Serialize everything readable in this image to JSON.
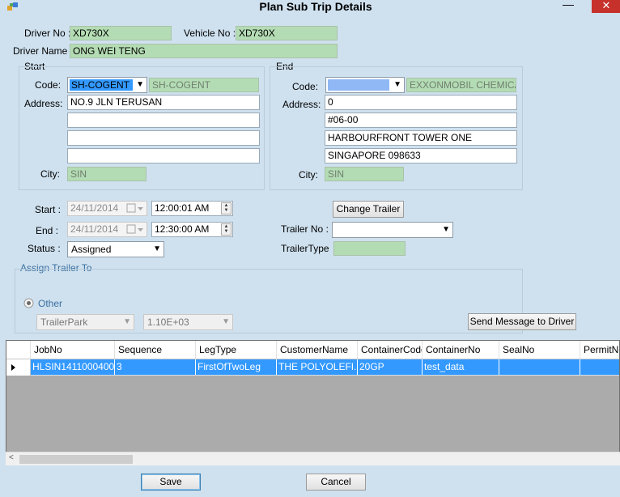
{
  "window": {
    "title": "Plan Sub Trip Details",
    "minimize_glyph": "—",
    "close_glyph": "✕"
  },
  "header": {
    "driver_no_label": "Driver No :",
    "driver_no_value": "XD730X",
    "vehicle_no_label": "Vehicle No :",
    "vehicle_no_value": "XD730X",
    "driver_name_label": "Driver Name :",
    "driver_name_value": "ONG WEI TENG"
  },
  "start": {
    "group_label": "Start",
    "code_label": "Code:",
    "code_selected": "SH-COGENT",
    "code_display": "SH-COGENT",
    "address_label": "Address:",
    "address_lines": [
      "NO.9 JLN TERUSAN",
      "",
      "",
      ""
    ],
    "city_label": "City:",
    "city_value": "SIN"
  },
  "end": {
    "group_label": "End",
    "code_label": "Code:",
    "code_selected": "",
    "code_display": "EXXONMOBIL CHEMICAL A",
    "address_label": "Address:",
    "address_lines": [
      "0",
      "#06-00",
      "HARBOURFRONT TOWER ONE",
      "SINGAPORE 098633"
    ],
    "city_label": "City:",
    "city_value": "SIN"
  },
  "schedule": {
    "start_label": "Start :",
    "start_date": "24/11/2014",
    "start_time": "12:00:01 AM",
    "end_label": "End :",
    "end_date": "24/11/2014",
    "end_time": "12:30:00 AM",
    "status_label": "Status :",
    "status_value": "Assigned"
  },
  "trailer": {
    "change_trailer_button": "Change Trailer",
    "trailer_no_label": "Trailer No :",
    "trailer_no_value": "",
    "trailer_type_label": "TrailerType",
    "trailer_type_value": ""
  },
  "assign": {
    "group_label": "Assign Trailer To",
    "other_label": "Other",
    "trailer_park_value": "TrailerPark",
    "park_number_value": "1.10E+03",
    "send_message_button": "Send Message to Driver"
  },
  "grid": {
    "columns": [
      "JobNo",
      "Sequence",
      "LegType",
      "CustomerName",
      "ContainerCode",
      "ContainerNo",
      "SealNo",
      "PermitNo"
    ],
    "rows": [
      [
        "HLSIN1411000400",
        "3",
        "FirstOfTwoLeg",
        "THE POLYOLEFI...",
        "20GP",
        "test_data",
        "",
        ""
      ]
    ]
  },
  "footer": {
    "save_button": "Save",
    "cancel_button": "Cancel"
  },
  "colors": {
    "form_bg": "#cfe1ef",
    "readonly_bg": "#b4dcb4",
    "selection_bg": "#3399ff",
    "close_bg": "#c7312b"
  }
}
